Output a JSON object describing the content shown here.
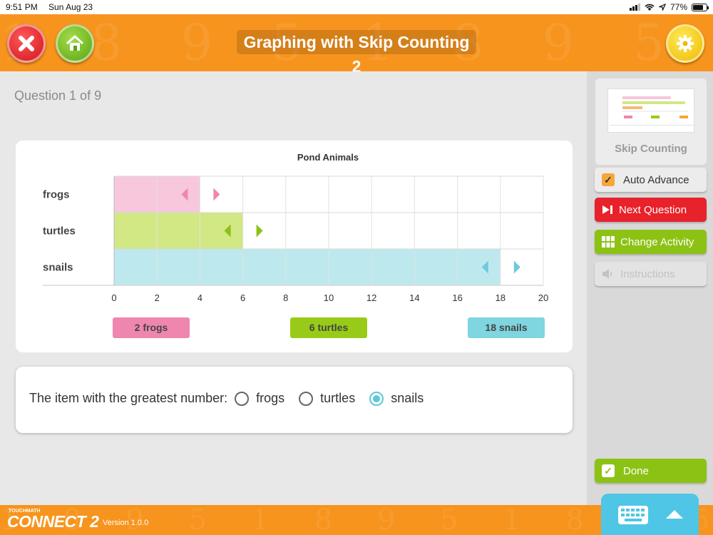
{
  "status_bar": {
    "time": "9:51 PM",
    "date": "Sun Aug 23",
    "battery": "77%"
  },
  "header": {
    "title": "Graphing with Skip Counting 2"
  },
  "question": {
    "label": "Question 1 of 9"
  },
  "chart_data": {
    "type": "bar",
    "orientation": "horizontal",
    "title": "Pond Animals",
    "categories": [
      "frogs",
      "turtles",
      "snails"
    ],
    "values": [
      4,
      6,
      18
    ],
    "colors": [
      "#f7c7dc",
      "#d1e884",
      "#bde9ee"
    ],
    "arrow_colors": [
      "#ef86b0",
      "#8cc214",
      "#6dc9dd"
    ],
    "xlim": [
      0,
      20
    ],
    "xticks": [
      "0",
      "2",
      "4",
      "6",
      "8",
      "10",
      "12",
      "14",
      "16",
      "18",
      "20"
    ],
    "grid": true
  },
  "targets": [
    {
      "label": "2 frogs",
      "color": "#ef86b0"
    },
    {
      "label": "6 turtles",
      "color": "#98cb17"
    },
    {
      "label": "18 snails",
      "color": "#7fd5e0"
    }
  ],
  "answer": {
    "prompt": "The item with the greatest number:",
    "options": [
      "frogs",
      "turtles",
      "snails"
    ],
    "selected": "snails"
  },
  "sidebar": {
    "activity_label": "Skip Counting",
    "auto_advance": "Auto Advance",
    "next_question": "Next Question",
    "change_activity": "Change Activity",
    "instructions": "Instructions",
    "done": "Done"
  },
  "footer": {
    "brand_small": "TOUCHMATH",
    "brand": "CONNECT 2",
    "version": "Version 1.0.0"
  }
}
